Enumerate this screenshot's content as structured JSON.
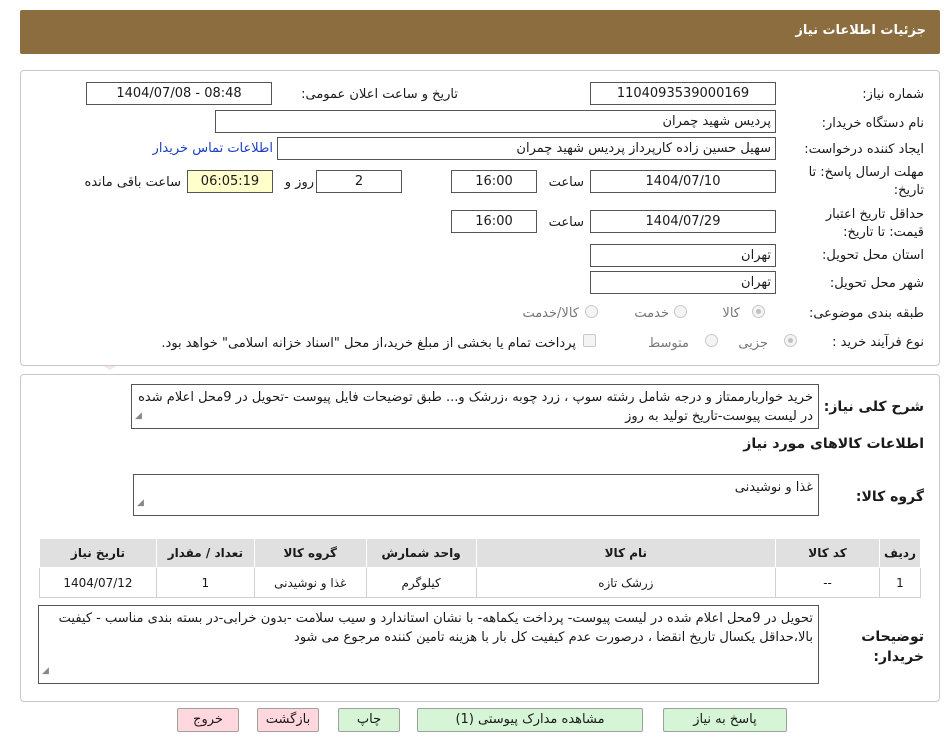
{
  "header": {
    "title": "جزئیات اطلاعات نیاز"
  },
  "form": {
    "need_number_label": "شماره نیاز:",
    "need_number": "1104093539000169",
    "announce_label": "تاریخ و ساعت اعلان عمومی:",
    "announce_value": "1404/07/08 - 08:48",
    "buyer_org_label": "نام دستگاه خریدار:",
    "buyer_org": "پردیس شهید چمران",
    "requester_label": "ایجاد کننده درخواست:",
    "requester": "سهیل حسین زاده کارپرداز پردیس شهید چمران",
    "contact_link": "اطلاعات تماس خریدار",
    "deadline_label": "مهلت ارسال پاسخ: تا تاریخ:",
    "deadline_date": "1404/07/10",
    "time_word": "ساعت",
    "deadline_time": "16:00",
    "days_value": "2",
    "days_word": "روز و",
    "remaining_time": "06:05:19",
    "remaining_word": "ساعت باقی مانده",
    "validity_label": "حداقل تاریخ اعتبار قیمت: تا تاریخ:",
    "validity_date": "1404/07/29",
    "validity_time": "16:00",
    "province_label": "استان محل تحویل:",
    "province": "تهران",
    "city_label": "شهر محل تحویل:",
    "city": "تهران",
    "category_label": "طبقه بندی موضوعی:",
    "category_options": [
      "کالا",
      "خدمت",
      "کالا/خدمت"
    ],
    "process_label": "نوع فرآیند خرید :",
    "process_options": [
      "جزیی",
      "متوسط"
    ],
    "payment_note": "پرداخت تمام یا بخشی از مبلغ خرید،از محل \"اسناد خزانه اسلامی\" خواهد بود."
  },
  "description": {
    "label": "شرح کلی نیاز:",
    "text": "خرید خواربارممتاز و درجه شامل رشته سوپ ، زرد چوبه ،زرشک و... طبق توضیحات فایل پیوست -تحویل در 9محل اعلام شده در لیست پیوست-تاریخ تولید به روز"
  },
  "goods": {
    "section_title": "اطلاعات کالاهای مورد نیاز",
    "group_label": "گروه کالا:",
    "group_value": "غذا و نوشیدنی",
    "columns": [
      "ردیف",
      "کد کالا",
      "نام کالا",
      "واحد شمارش",
      "گروه کالا",
      "تعداد / مقدار",
      "تاریخ نیاز"
    ],
    "rows": [
      [
        "1",
        "--",
        "زرشک تازه",
        "کیلوگرم",
        "غذا و نوشیدنی",
        "1",
        "1404/07/12"
      ]
    ]
  },
  "buyer_notes": {
    "label": "توضیحات خریدار:",
    "text": "تحویل در 9محل اعلام شده در لیست پیوست- پرداخت یکماهه- با نشان استاندارد و سیب سلامت -بدون خرابی-در بسته بندی مناسب - کیفیت بالا،حداقل یکسال تاریخ انقضا ، درصورت عدم کیفیت کل بار با هزینه تامین کننده مرجوع می شود"
  },
  "buttons": {
    "reply": "پاسخ به نیاز",
    "attachments": "مشاهده مدارک پیوستی (1)",
    "print": "چاپ",
    "back": "بازگشت",
    "exit": "خروج"
  },
  "colors": {
    "header_bg": "#8b6d3f",
    "button_green": "#d6f5d6",
    "button_pink": "#ffd7dc",
    "link": "#1c3fc4"
  },
  "watermark": {
    "text": "AriaTender.neT"
  }
}
